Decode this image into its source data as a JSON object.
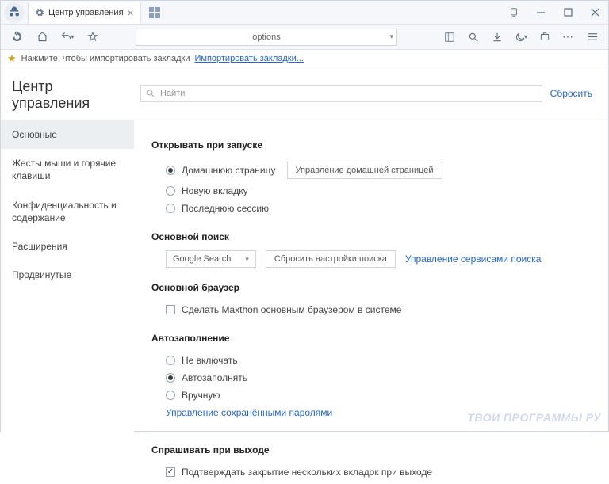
{
  "titlebar": {
    "tab_title": "Центр управления"
  },
  "toolbar": {
    "address": "options"
  },
  "bookmark_bar": {
    "hint": "Нажмите, чтобы импортировать закладки",
    "link": "Импортировать закладки..."
  },
  "header": {
    "title": "Центр управления",
    "search_placeholder": "Найти",
    "reset": "Сбросить"
  },
  "sidebar": {
    "items": [
      "Основные",
      "Жесты мыши и горячие клавиши",
      "Конфиденциальность и содержание",
      "Расширения",
      "Продвинутые"
    ]
  },
  "sections": {
    "startup": {
      "title": "Открывать при запуске",
      "home": "Домашнюю страницу",
      "manage_home": "Управление домашней страницей",
      "newtab": "Новую вкладку",
      "lastsession": "Последнюю сессию"
    },
    "search": {
      "title": "Основной поиск",
      "engine": "Google Search",
      "reset": "Сбросить настройки поиска",
      "manage": "Управление сервисами поиска"
    },
    "browser": {
      "title": "Основной браузер",
      "make_default": "Сделать Maxthon основным браузером в системе"
    },
    "autofill": {
      "title": "Автозаполнение",
      "off": "Не включать",
      "auto": "Автозаполнять",
      "manual": "Вручную",
      "manage_pw": "Управление сохранёнными паролями"
    },
    "ask_exit": {
      "title": "Спрашивать при выходе",
      "confirm_close": "Подтверждать закрытие нескольких вкладок при выходе"
    }
  },
  "watermark": "ТВОИ ПРОГРАММЫ РУ"
}
